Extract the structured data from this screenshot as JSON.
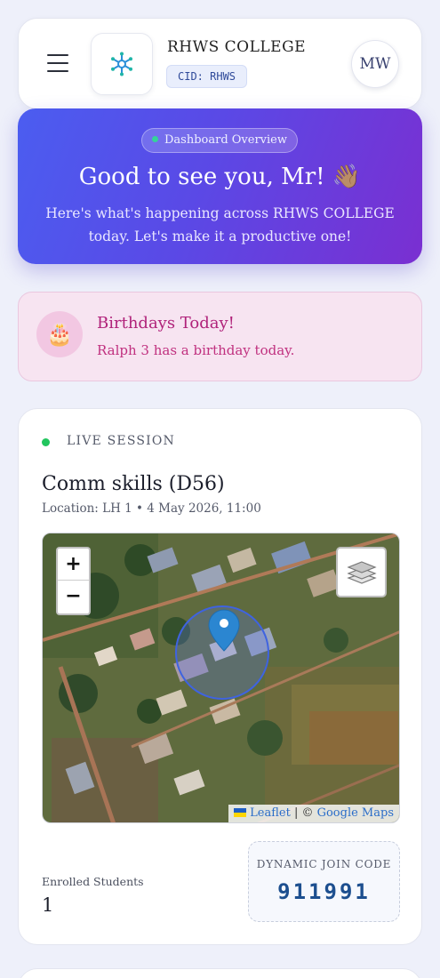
{
  "header": {
    "college_name": "RHWS COLLEGE",
    "cid": "CID: RHWS",
    "avatar_initials": "MW",
    "menu_icon": "hamburger-menu-icon",
    "logo_icon": "snowflake-logo-icon"
  },
  "banner": {
    "pill": "Dashboard Overview",
    "greeting": "Good to see you, Mr! 👋🏽",
    "subtitle": "Here's what's happening across RHWS COLLEGE today. Let's make it a productive one!"
  },
  "birthday": {
    "icon": "🎂",
    "title": "Birthdays Today!",
    "text": "Ralph 3 has a birthday today."
  },
  "session": {
    "status": "LIVE SESSION",
    "course": "Comm skills (D56)",
    "meta": "Location: LH 1 • 4 May 2026, 11:00",
    "map": {
      "zoom_in": "+",
      "zoom_out": "−",
      "layers_icon": "layers-icon",
      "attribution_leaflet": "Leaflet",
      "attribution_separator": " | © ",
      "attribution_source": "Google Maps"
    },
    "enrolled_label": "Enrolled Students",
    "enrolled_value": "1",
    "join_label": "DYNAMIC JOIN CODE",
    "join_code": "911991"
  },
  "colors": {
    "banner_start": "#4b5df0",
    "banner_end": "#7a2fd1",
    "live_dot": "#22c55e",
    "birthday_text": "#b0227a",
    "join_code": "#1d4f8f"
  }
}
